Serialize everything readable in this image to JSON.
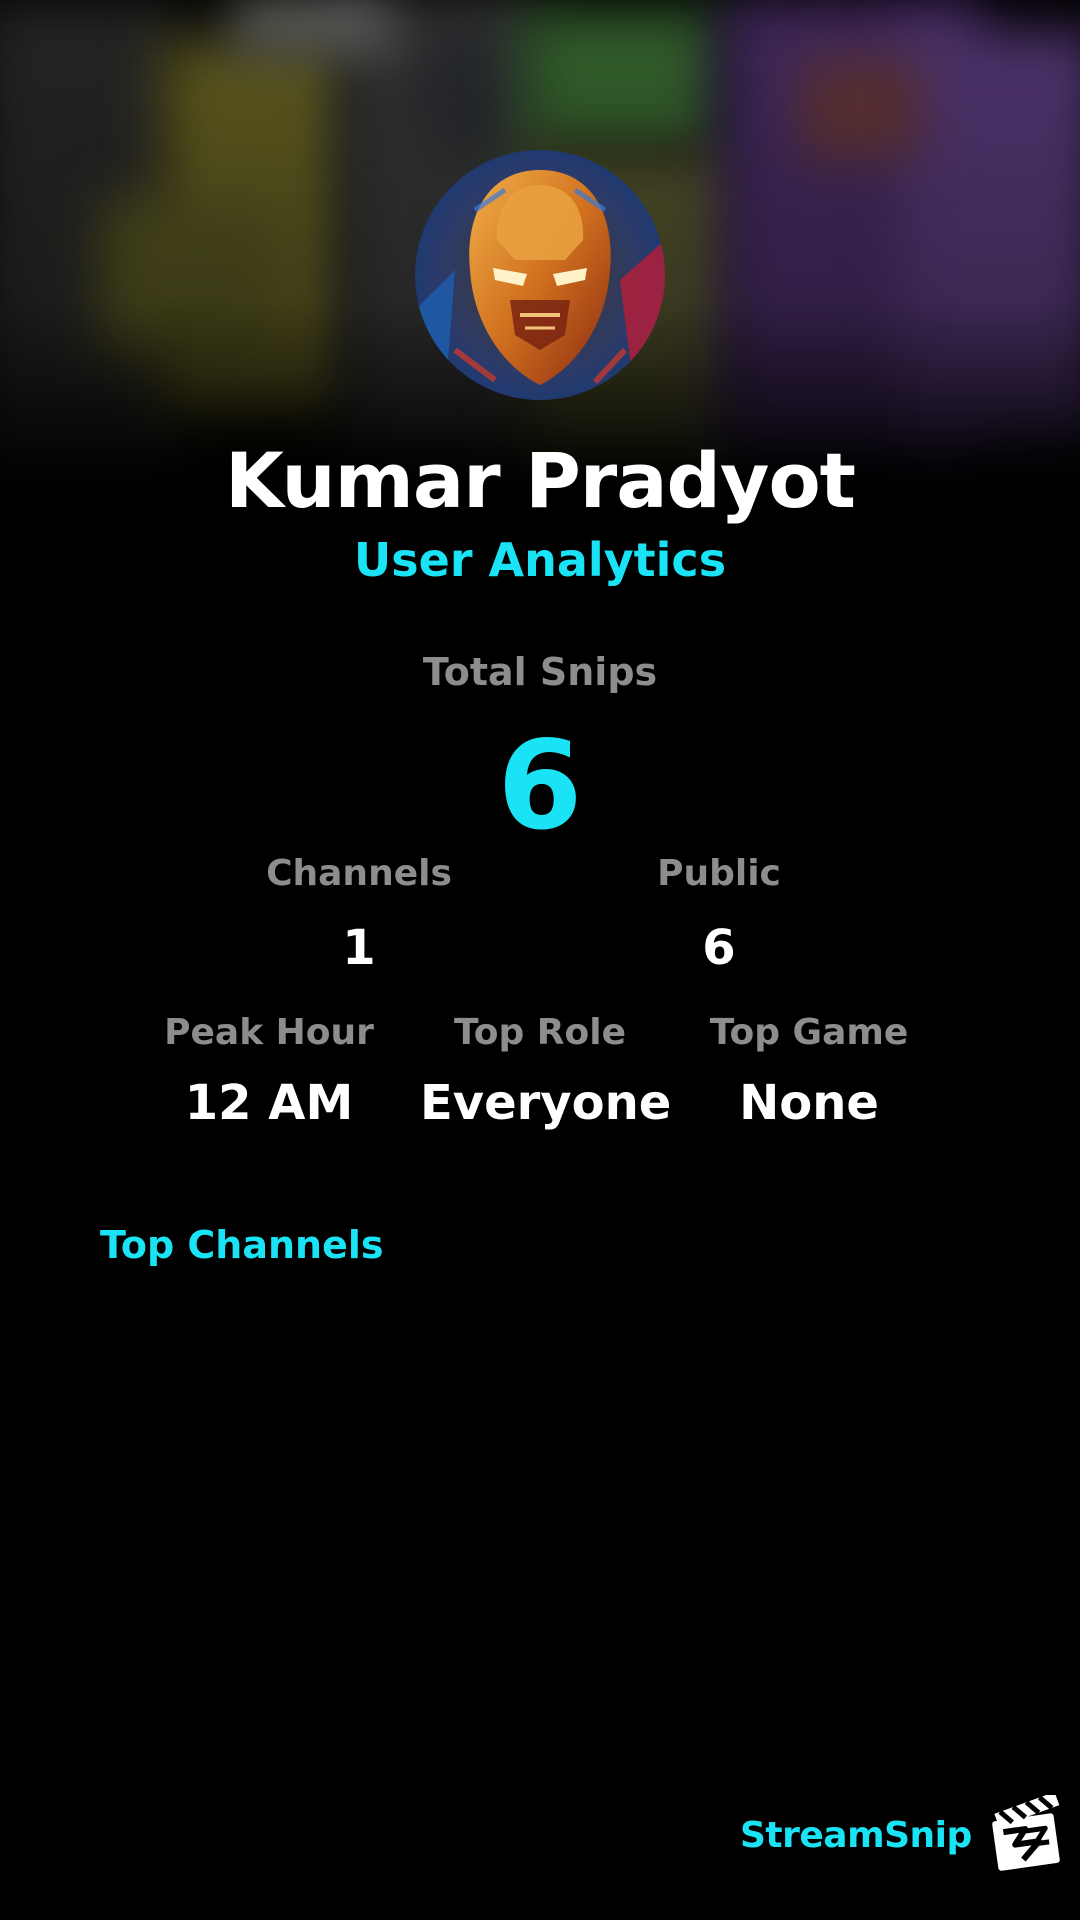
{
  "profile": {
    "display_name": "Kumar Pradyot",
    "subtitle": "User Analytics",
    "avatar_icon": "iron-man-avatar"
  },
  "totals": {
    "total_snips_label": "Total Snips",
    "total_snips_value": "6"
  },
  "stats_row_1": {
    "channels_label": "Channels",
    "channels_value": "1",
    "public_label": "Public",
    "public_value": "6"
  },
  "stats_row_2": {
    "peak_hour_label": "Peak Hour",
    "peak_hour_value": "12 AM",
    "top_role_label": "Top Role",
    "top_role_value": "Everyone",
    "top_game_label": "Top Game",
    "top_game_value": "None"
  },
  "sections": {
    "top_channels_title": "Top Channels"
  },
  "branding": {
    "name": "StreamSnip",
    "logo_icon": "clapperboard-logo-icon"
  },
  "colors": {
    "accent": "#19e3f5",
    "label_gray": "#8d8d8d",
    "background": "#000000",
    "text": "#ffffff"
  }
}
